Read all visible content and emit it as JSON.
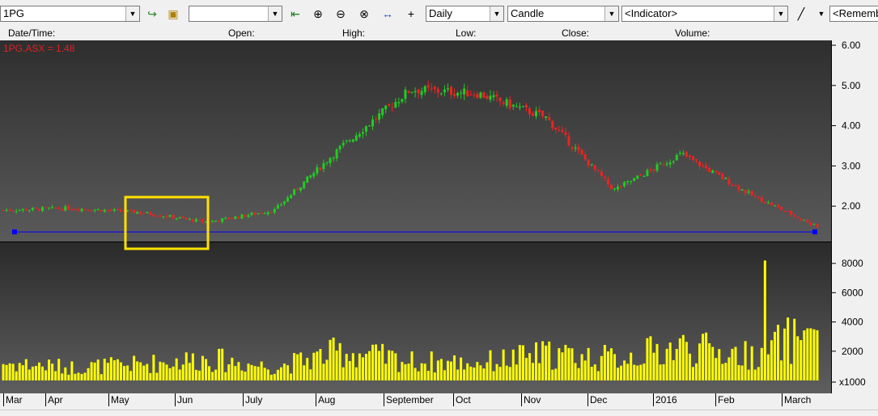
{
  "toolbar": {
    "symbol": "1PG",
    "period": "Daily",
    "chart_type": "Candle",
    "indicator": "<Indicator>",
    "remember": "<Rememb",
    "icons": [
      "go-arrow-icon",
      "folder-icon",
      "zoom-reset-icon",
      "zoom-in-icon",
      "zoom-out-icon",
      "zoom-select-icon",
      "fit-width-icon",
      "crosshair-icon",
      "line-tool-icon"
    ]
  },
  "info_bar": {
    "datetime": "Date/Time:",
    "open": "Open:",
    "high": "High:",
    "low": "Low:",
    "close": "Close:",
    "volume": "Volume:"
  },
  "chart_data": [
    {
      "type": "candlestick",
      "label": "1PG.ASX = 1.48",
      "ylim": [
        1.0,
        6.0
      ],
      "yticks": [
        "6.00",
        "5.00",
        "4.00",
        "3.00",
        "2.00"
      ],
      "support_line": 1.5,
      "x": [
        "Mar",
        "Apr",
        "May",
        "Jun",
        "July",
        "Aug",
        "September",
        "Oct",
        "Nov",
        "Dec",
        "2016",
        "Feb",
        "March"
      ],
      "close_trend": [
        1.9,
        1.95,
        1.85,
        1.6,
        1.9,
        3.5,
        4.9,
        4.8,
        4.2,
        2.4,
        3.3,
        2.3,
        1.48
      ],
      "colors": {
        "up": "#22cc22",
        "down": "#ee2222",
        "line": "#0000ff",
        "highlight": "#ffe000"
      }
    },
    {
      "type": "bar",
      "ylim": [
        0,
        9000
      ],
      "yticks": [
        "8000",
        "6000",
        "4000",
        "2000",
        "x1000"
      ],
      "color": "#ffff00",
      "volume_trend": [
        1200,
        900,
        1100,
        1500,
        900,
        2000,
        1300,
        1200,
        1800,
        1500,
        2300,
        1700,
        3500
      ]
    }
  ],
  "dates": [
    "Mar",
    "Apr",
    "May",
    "Jun",
    "July",
    "Aug",
    "September",
    "Oct",
    "Nov",
    "Dec",
    "2016",
    "Feb",
    "March"
  ]
}
